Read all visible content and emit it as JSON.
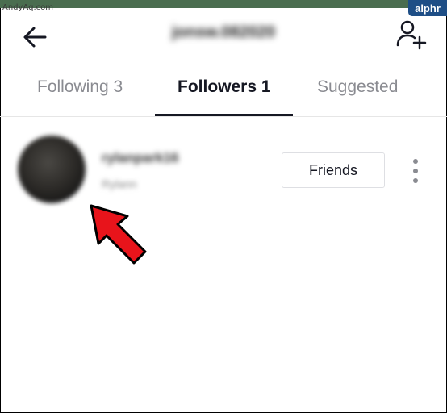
{
  "watermark": "AndyAq.com",
  "brand": "alphr",
  "header": {
    "title": "jonsw.082020"
  },
  "tabs": [
    {
      "label": "Following 3",
      "active": false
    },
    {
      "label": "Followers 1",
      "active": true
    },
    {
      "label": "Suggested",
      "active": false
    }
  ],
  "follower": {
    "username": "rylanpark16",
    "subtitle": "Rylann",
    "button_label": "Friends"
  },
  "colors": {
    "active_tab": "#161823",
    "inactive_tab": "#8a8b91",
    "arrow": "#e8141b"
  }
}
